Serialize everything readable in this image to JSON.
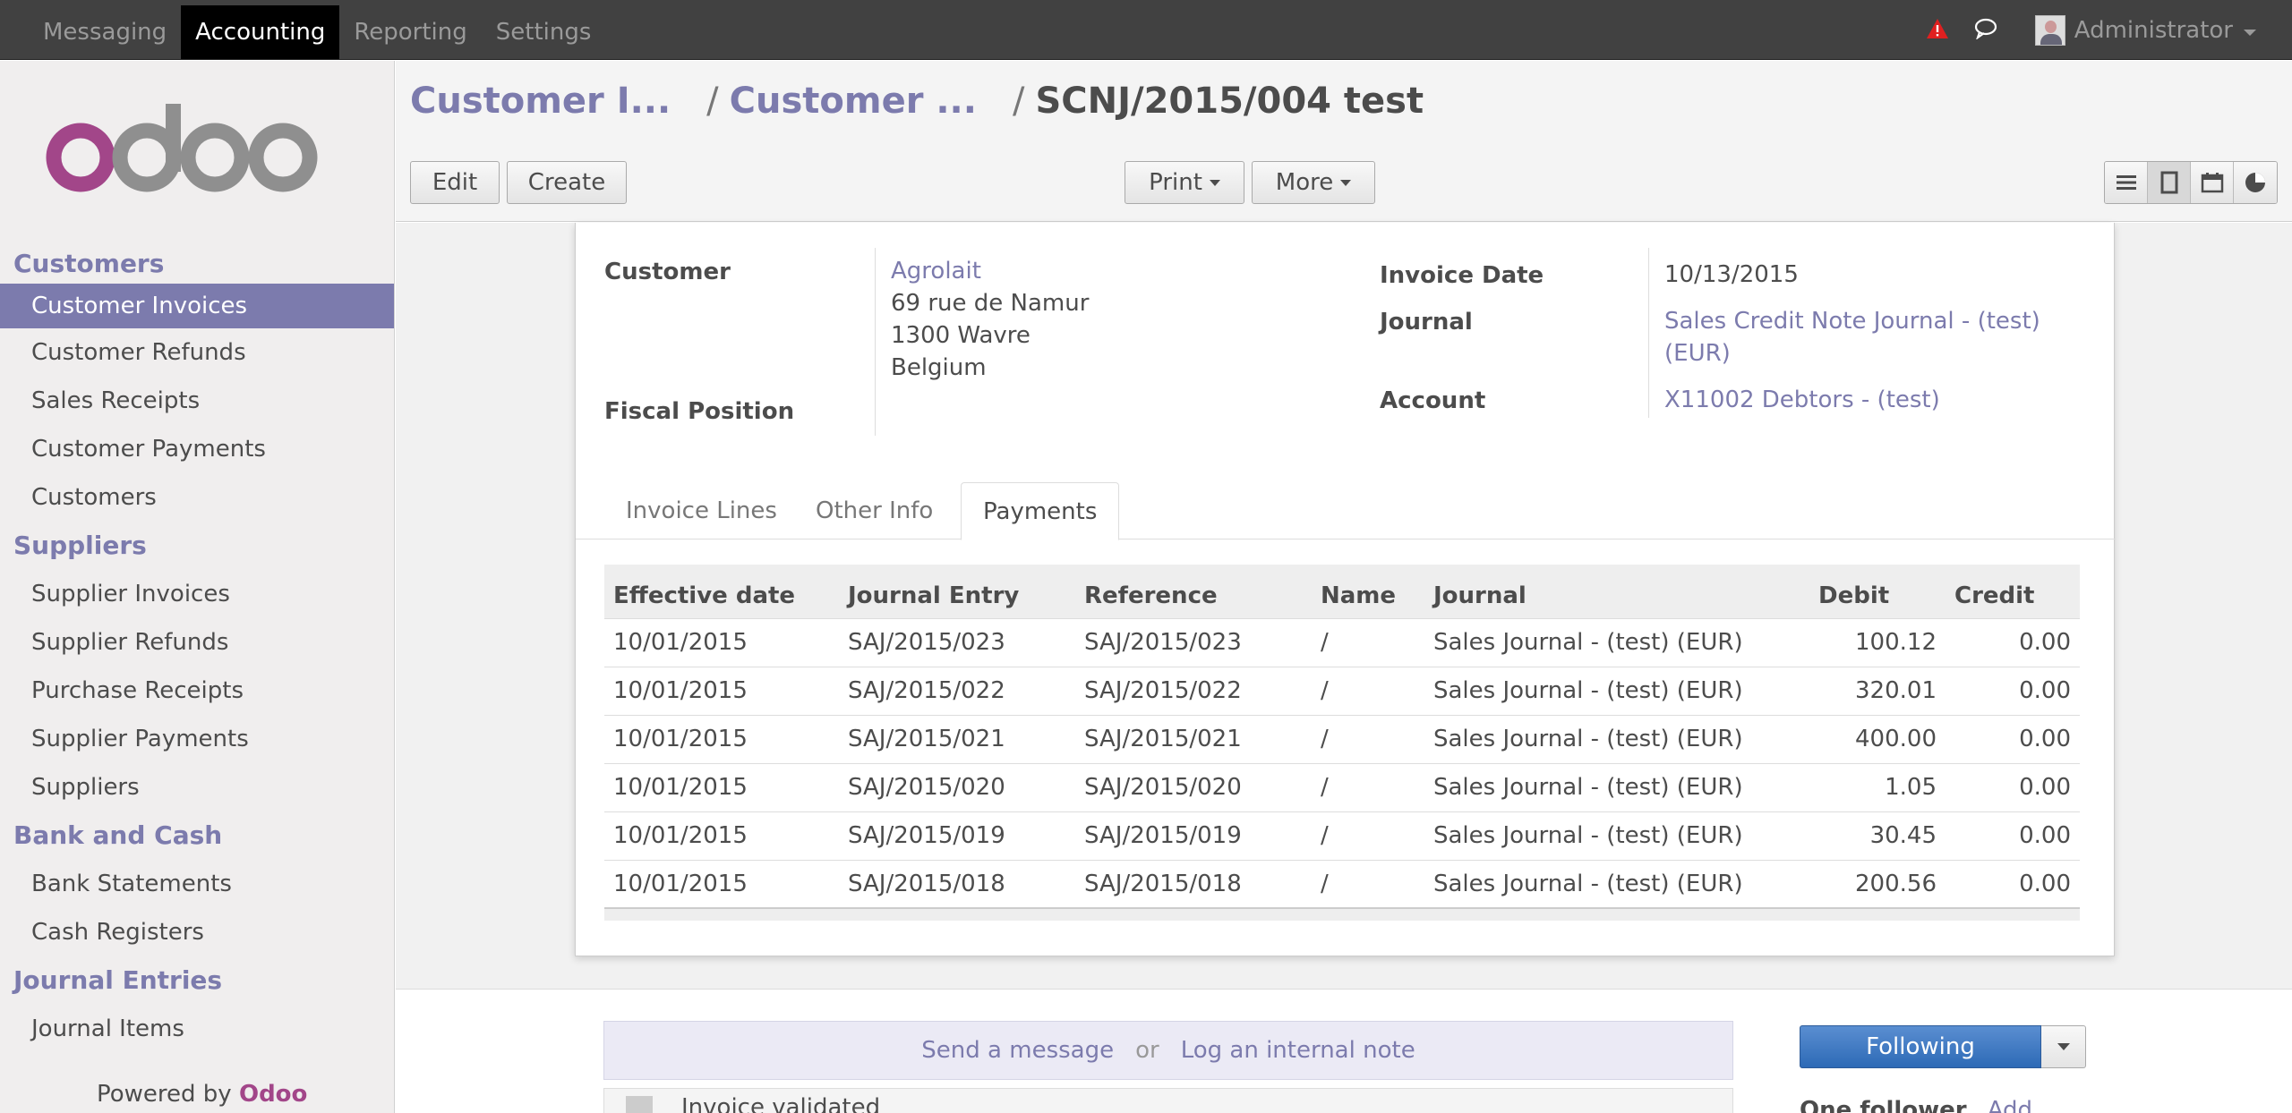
{
  "topbar": {
    "menu": [
      "Messaging",
      "Accounting",
      "Reporting",
      "Settings"
    ],
    "active_menu": "Accounting",
    "user": "Administrator"
  },
  "sidebar": {
    "logo_alt": "odoo",
    "sections": [
      {
        "title": "Customers",
        "items": [
          "Customer Invoices",
          "Customer Refunds",
          "Sales Receipts",
          "Customer Payments",
          "Customers"
        ]
      },
      {
        "title": "Suppliers",
        "items": [
          "Supplier Invoices",
          "Supplier Refunds",
          "Purchase Receipts",
          "Supplier Payments",
          "Suppliers"
        ]
      },
      {
        "title": "Bank and Cash",
        "items": [
          "Bank Statements",
          "Cash Registers"
        ]
      },
      {
        "title": "Journal Entries",
        "items": [
          "Journal Items"
        ]
      }
    ],
    "active_item": "Customer Invoices",
    "powered_prefix": "Powered by",
    "powered_brand": "Odoo"
  },
  "breadcrumb": {
    "crumb1": "Customer I...",
    "crumb2": "Customer ...",
    "current": "SCNJ/2015/004 test",
    "sep": "/"
  },
  "toolbar": {
    "edit": "Edit",
    "create": "Create",
    "print": "Print",
    "more": "More"
  },
  "form": {
    "customer_label": "Customer",
    "customer_name": "Agrolait",
    "address1": "69 rue de Namur",
    "address2": "1300 Wavre",
    "address3": "Belgium",
    "fiscal_label": "Fiscal Position",
    "invoice_date_label": "Invoice Date",
    "invoice_date": "10/13/2015",
    "journal_label": "Journal",
    "journal_line1": "Sales Credit Note Journal - (test)",
    "journal_line2": "(EUR)",
    "account_label": "Account",
    "account": "X11002 Debtors - (test)"
  },
  "tabs": [
    "Invoice Lines",
    "Other Info",
    "Payments"
  ],
  "active_tab": "Payments",
  "payments": {
    "columns": [
      "Effective date",
      "Journal Entry",
      "Reference",
      "Name",
      "Journal",
      "Debit",
      "Credit"
    ],
    "rows": [
      [
        "10/01/2015",
        "SAJ/2015/023",
        "SAJ/2015/023",
        "/",
        "Sales Journal - (test) (EUR)",
        "100.12",
        "0.00"
      ],
      [
        "10/01/2015",
        "SAJ/2015/022",
        "SAJ/2015/022",
        "/",
        "Sales Journal - (test) (EUR)",
        "320.01",
        "0.00"
      ],
      [
        "10/01/2015",
        "SAJ/2015/021",
        "SAJ/2015/021",
        "/",
        "Sales Journal - (test) (EUR)",
        "400.00",
        "0.00"
      ],
      [
        "10/01/2015",
        "SAJ/2015/020",
        "SAJ/2015/020",
        "/",
        "Sales Journal - (test) (EUR)",
        "1.05",
        "0.00"
      ],
      [
        "10/01/2015",
        "SAJ/2015/019",
        "SAJ/2015/019",
        "/",
        "Sales Journal - (test) (EUR)",
        "30.45",
        "0.00"
      ],
      [
        "10/01/2015",
        "SAJ/2015/018",
        "SAJ/2015/018",
        "/",
        "Sales Journal - (test) (EUR)",
        "200.56",
        "0.00"
      ]
    ]
  },
  "chatter": {
    "send_message": "Send a message",
    "or": "or",
    "log_note": "Log an internal note",
    "message_text": "Invoice validated",
    "following": "Following",
    "followers": "One follower",
    "add": "Add"
  },
  "colors": {
    "accent": "#7c7bad",
    "brand": "#a24689",
    "following_btn": "#2d6ab6",
    "warning": "#e02020"
  }
}
